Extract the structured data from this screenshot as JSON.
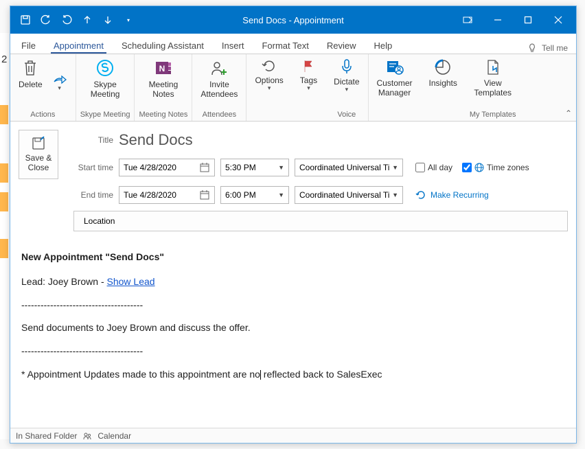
{
  "window": {
    "title": "Send Docs  -  Appointment"
  },
  "menu": {
    "file": "File",
    "appointment": "Appointment",
    "scheduling": "Scheduling Assistant",
    "insert": "Insert",
    "format": "Format Text",
    "review": "Review",
    "help": "Help",
    "tell_me": "Tell me"
  },
  "ribbon": {
    "delete": "Delete",
    "actions_group": "Actions",
    "skype_meeting": "Skype\nMeeting",
    "skype_group": "Skype Meeting",
    "meeting_notes": "Meeting\nNotes",
    "notes_group": "Meeting Notes",
    "invite_attendees": "Invite\nAttendees",
    "attendees_group": "Attendees",
    "options": "Options",
    "tags": "Tags",
    "dictate": "Dictate",
    "voice_group": "Voice",
    "customer_manager": "Customer\nManager",
    "insights": "Insights",
    "view_templates": "View\nTemplates",
    "templates_group": "My Templates"
  },
  "form": {
    "save_close": "Save & Close",
    "title_label": "Title",
    "title_value": "Send Docs",
    "start_label": "Start time",
    "end_label": "End time",
    "start_date": "Tue 4/28/2020",
    "start_time": "5:30 PM",
    "end_date": "Tue 4/28/2020",
    "end_time": "6:00 PM",
    "timezone": "Coordinated Universal Ti",
    "all_day": "All day",
    "time_zones": "Time zones",
    "recurring": "Make Recurring",
    "location": "Location"
  },
  "body": {
    "heading": "New Appointment \"Send Docs\"",
    "lead_prefix": "Lead: Joey Brown - ",
    "lead_link": "Show Lead",
    "sep": "--------------------------------------",
    "desc_before": "Send documents to Joey Brown and discuss the offer.",
    "note_before": "* Appointment Updates made to this appointment are no",
    "note_after": " reflected back to SalesExec"
  },
  "status": {
    "folder": "In Shared Folder",
    "calendar": "Calendar"
  }
}
